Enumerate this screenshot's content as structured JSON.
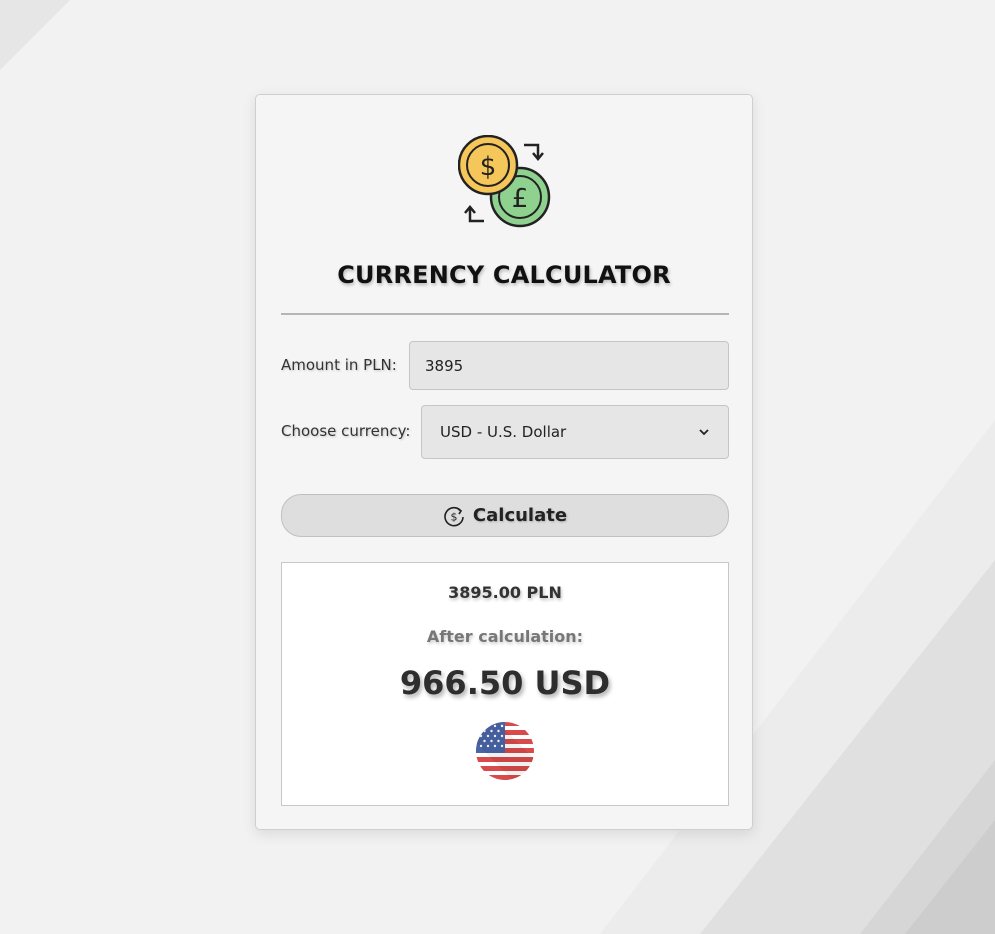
{
  "app": {
    "title": "CURRENCY CALCULATOR",
    "logo_icon": "currency-exchange-icon"
  },
  "form": {
    "amount_label": "Amount in PLN:",
    "amount_value": "3895",
    "currency_label": "Choose currency:",
    "currency_selected": "USD - U.S. Dollar",
    "calculate_label": "Calculate",
    "calculate_icon": "dollar-refresh-icon"
  },
  "result": {
    "input_amount": "3895.00 PLN",
    "caption": "After calculation:",
    "output_amount": "966.50 USD",
    "flag_icon": "us-flag-icon"
  },
  "colors": {
    "card_background": "#f5f5f5",
    "input_background": "#e6e6e6",
    "button_background": "#dedede",
    "coin_gold": "#f5c65a",
    "coin_green": "#8fd18f"
  }
}
